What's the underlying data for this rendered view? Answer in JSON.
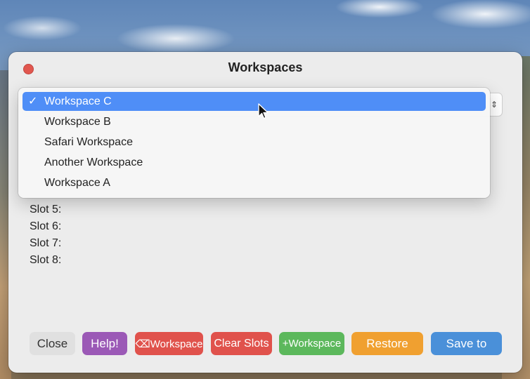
{
  "window": {
    "title": "Workspaces"
  },
  "popup": {
    "selected_label": "Workspace C",
    "stepper_glyph": "⇕",
    "items": [
      {
        "label": "Workspace C",
        "checked": "✓"
      },
      {
        "label": "Workspace B",
        "checked": ""
      },
      {
        "label": "Safari Workspace",
        "checked": ""
      },
      {
        "label": "Another Workspace",
        "checked": ""
      },
      {
        "label": "Workspace A",
        "checked": ""
      }
    ]
  },
  "slots": [
    "Slot 5:",
    "Slot 6:",
    "Slot 7:",
    "Slot 8:"
  ],
  "buttons": {
    "close": "Close",
    "help": "Help!",
    "delete_workspace": "⌫Workspace",
    "clear_slots": "Clear Slots",
    "add_workspace": "+Workspace",
    "restore": "Restore",
    "save_to": "Save to"
  },
  "colors": {
    "accent": "#4f8ef7",
    "help": "#9b59b6",
    "danger": "#e0524c",
    "success": "#5cb85c",
    "warning": "#f0a030",
    "primary": "#4a90d9"
  }
}
